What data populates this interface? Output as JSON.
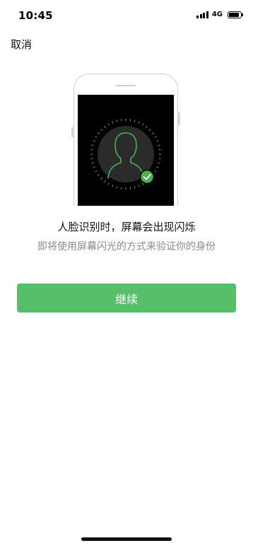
{
  "status_bar": {
    "time": "10:45",
    "network": "4G",
    "signal_icon": "cellular-signal-icon",
    "battery_icon": "battery-icon",
    "battery_level": 0.85
  },
  "nav": {
    "cancel_label": "取消"
  },
  "illustration": {
    "icons": [
      "phone-outline-icon",
      "face-silhouette-icon",
      "checkmark-icon"
    ],
    "accent_color": "#4cb050",
    "screen_color": "#000000"
  },
  "main": {
    "headline": "人脸识别时，屏幕会出现闪烁",
    "subtitle": "即将使用屏幕闪光的方式来验证你的身份",
    "continue_label": "继续"
  },
  "colors": {
    "button": "#57be6a",
    "subtitle_text": "#8a8a8a"
  }
}
